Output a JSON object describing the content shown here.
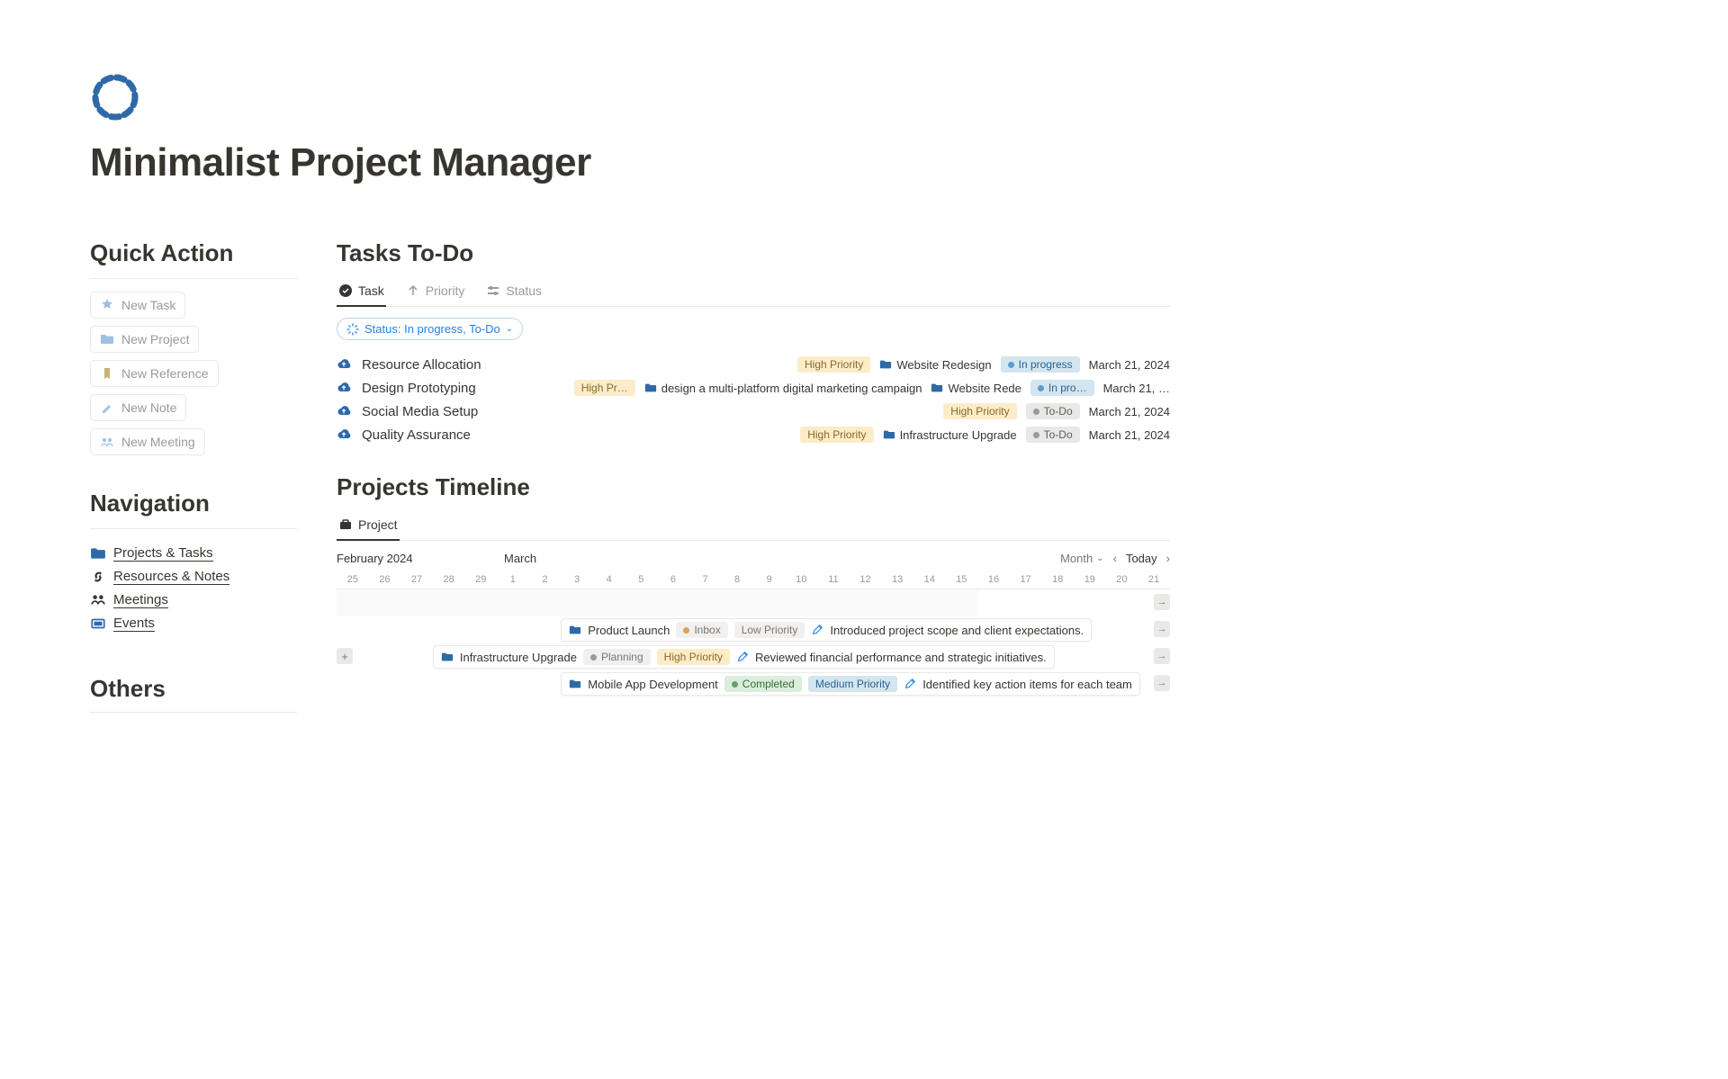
{
  "page": {
    "title": "Minimalist Project Manager"
  },
  "quick_action": {
    "title": "Quick Action",
    "items": [
      {
        "label": "New Task"
      },
      {
        "label": "New Project"
      },
      {
        "label": "New Reference"
      },
      {
        "label": "New Note"
      },
      {
        "label": "New Meeting"
      }
    ]
  },
  "navigation": {
    "title": "Navigation",
    "items": [
      {
        "label": "Projects & Tasks"
      },
      {
        "label": "Resources & Notes"
      },
      {
        "label": "Meetings"
      },
      {
        "label": "Events"
      }
    ]
  },
  "others": {
    "title": "Others"
  },
  "tasks": {
    "title": "Tasks To-Do",
    "tabs": {
      "task": "Task",
      "priority": "Priority",
      "status": "Status"
    },
    "filter": "Status: In progress, To-Do",
    "rows": [
      {
        "name": "Resource Allocation",
        "priority": "High Priority",
        "project": "Website Redesign",
        "status": "In progress",
        "date": "March 21, 2024"
      },
      {
        "name": "Design Prototyping",
        "priority": "High Pr…",
        "desc": "design a multi-platform digital marketing campaign",
        "project": "Website Rede",
        "status": "In pro…",
        "date": "March 21, …"
      },
      {
        "name": "Social Media Setup",
        "priority": "High Priority",
        "status": "To-Do",
        "date": "March 21, 2024"
      },
      {
        "name": "Quality Assurance",
        "priority": "High Priority",
        "project": "Infrastructure Upgrade",
        "status": "To-Do",
        "date": "March 21, 2024"
      }
    ]
  },
  "timeline": {
    "title": "Projects Timeline",
    "tab": "Project",
    "month1": "February 2024",
    "month2": "March",
    "view": "Month",
    "today": "Today",
    "days": [
      "25",
      "26",
      "27",
      "28",
      "29",
      "1",
      "2",
      "3",
      "4",
      "5",
      "6",
      "7",
      "8",
      "9",
      "10",
      "11",
      "12",
      "13",
      "14",
      "15",
      "16",
      "17",
      "18",
      "19",
      "20",
      "21"
    ],
    "bars": [
      {
        "name": "Product Launch",
        "tag": "Inbox",
        "tag_class": "inbox",
        "dot": "orange",
        "priority": "Low Priority",
        "pr_class": "low",
        "note": "Introduced project scope and client expectations.",
        "left_day": 8
      },
      {
        "name": "Infrastructure Upgrade",
        "tag": "Planning",
        "tag_class": "planning",
        "dot": "grey",
        "priority": "High Priority",
        "pr_class": "high",
        "note": "Reviewed financial performance and strategic initiatives.",
        "left_day": 4,
        "has_plus": true
      },
      {
        "name": "Mobile App Development",
        "tag": "Completed",
        "tag_class": "completed",
        "dot": "green",
        "priority": "Medium Priority",
        "pr_class": "medium",
        "note": "Identified key action items for each team",
        "left_day": 8
      }
    ]
  }
}
